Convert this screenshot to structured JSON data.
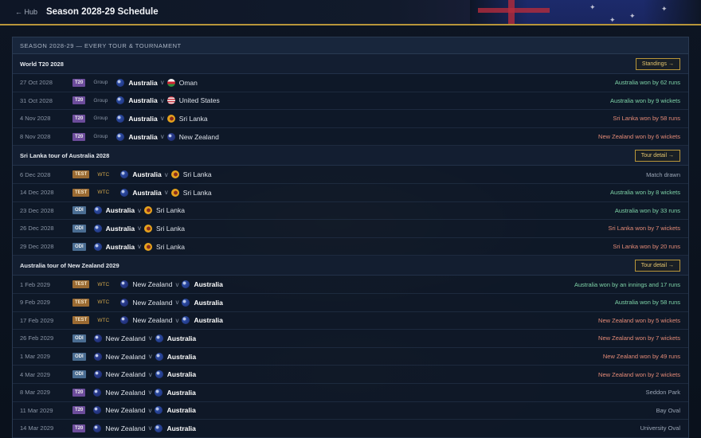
{
  "topbar": {
    "back_label": "← Hub",
    "title": "Season 2028-29 Schedule"
  },
  "panel": {
    "header": "SEASON 2028-29 — EVERY TOUR & TOURNAMENT"
  },
  "sections": [
    {
      "title": "World T20 2028",
      "button": "Standings →",
      "matches": [
        {
          "date": "27 Oct 2028",
          "format": "T20",
          "comp": "Group",
          "home": "Australia",
          "home_flag": "aus",
          "away": "Oman",
          "away_flag": "oman",
          "bold": "home",
          "result": "Australia won by 62 runs",
          "result_type": "win"
        },
        {
          "date": "31 Oct 2028",
          "format": "T20",
          "comp": "Group",
          "home": "Australia",
          "home_flag": "aus",
          "away": "United States",
          "away_flag": "usa",
          "bold": "home",
          "result": "Australia won by 9 wickets",
          "result_type": "win"
        },
        {
          "date": "4 Nov 2028",
          "format": "T20",
          "comp": "Group",
          "home": "Australia",
          "home_flag": "aus",
          "away": "Sri Lanka",
          "away_flag": "sl",
          "bold": "home",
          "result": "Sri Lanka won by 58 runs",
          "result_type": "loss"
        },
        {
          "date": "8 Nov 2028",
          "format": "T20",
          "comp": "Group",
          "home": "Australia",
          "home_flag": "aus",
          "away": "New Zealand",
          "away_flag": "nz",
          "bold": "home",
          "result": "New Zealand won by 6 wickets",
          "result_type": "loss"
        }
      ]
    },
    {
      "title": "Sri Lanka tour of Australia 2028",
      "button": "Tour detail →",
      "matches": [
        {
          "date": "6 Dec 2028",
          "format": "TEST",
          "comp": "WTC",
          "home": "Australia",
          "home_flag": "aus",
          "away": "Sri Lanka",
          "away_flag": "sl",
          "bold": "home",
          "result": "Match drawn",
          "result_type": "neutral"
        },
        {
          "date": "14 Dec 2028",
          "format": "TEST",
          "comp": "WTC",
          "home": "Australia",
          "home_flag": "aus",
          "away": "Sri Lanka",
          "away_flag": "sl",
          "bold": "home",
          "result": "Australia won by 8 wickets",
          "result_type": "win"
        },
        {
          "date": "23 Dec 2028",
          "format": "ODI",
          "comp": "",
          "home": "Australia",
          "home_flag": "aus",
          "away": "Sri Lanka",
          "away_flag": "sl",
          "bold": "home",
          "result": "Australia won by 33 runs",
          "result_type": "win"
        },
        {
          "date": "26 Dec 2028",
          "format": "ODI",
          "comp": "",
          "home": "Australia",
          "home_flag": "aus",
          "away": "Sri Lanka",
          "away_flag": "sl",
          "bold": "home",
          "result": "Sri Lanka won by 7 wickets",
          "result_type": "loss"
        },
        {
          "date": "29 Dec 2028",
          "format": "ODI",
          "comp": "",
          "home": "Australia",
          "home_flag": "aus",
          "away": "Sri Lanka",
          "away_flag": "sl",
          "bold": "home",
          "result": "Sri Lanka won by 20 runs",
          "result_type": "loss"
        }
      ]
    },
    {
      "title": "Australia tour of New Zealand 2029",
      "button": "Tour detail →",
      "matches": [
        {
          "date": "1 Feb 2029",
          "format": "TEST",
          "comp": "WTC",
          "home": "New Zealand",
          "home_flag": "nz",
          "away": "Australia",
          "away_flag": "aus",
          "bold": "away",
          "result": "Australia won by an innings and 17 runs",
          "result_type": "win"
        },
        {
          "date": "9 Feb 2029",
          "format": "TEST",
          "comp": "WTC",
          "home": "New Zealand",
          "home_flag": "nz",
          "away": "Australia",
          "away_flag": "aus",
          "bold": "away",
          "result": "Australia won by 58 runs",
          "result_type": "win"
        },
        {
          "date": "17 Feb 2029",
          "format": "TEST",
          "comp": "WTC",
          "home": "New Zealand",
          "home_flag": "nz",
          "away": "Australia",
          "away_flag": "aus",
          "bold": "away",
          "result": "New Zealand won by 5 wickets",
          "result_type": "loss"
        },
        {
          "date": "26 Feb 2029",
          "format": "ODI",
          "comp": "",
          "home": "New Zealand",
          "home_flag": "nz",
          "away": "Australia",
          "away_flag": "aus",
          "bold": "away",
          "result": "New Zealand won by 7 wickets",
          "result_type": "loss"
        },
        {
          "date": "1 Mar 2029",
          "format": "ODI",
          "comp": "",
          "home": "New Zealand",
          "home_flag": "nz",
          "away": "Australia",
          "away_flag": "aus",
          "bold": "away",
          "result": "New Zealand won by 49 runs",
          "result_type": "loss"
        },
        {
          "date": "4 Mar 2029",
          "format": "ODI",
          "comp": "",
          "home": "New Zealand",
          "home_flag": "nz",
          "away": "Australia",
          "away_flag": "aus",
          "bold": "away",
          "result": "New Zealand won by 2 wickets",
          "result_type": "loss"
        },
        {
          "date": "8 Mar 2029",
          "format": "T20",
          "comp": "",
          "home": "New Zealand",
          "home_flag": "nz",
          "away": "Australia",
          "away_flag": "aus",
          "bold": "away",
          "result": "Seddon Park",
          "result_type": "neutral"
        },
        {
          "date": "11 Mar 2029",
          "format": "T20",
          "comp": "",
          "home": "New Zealand",
          "home_flag": "nz",
          "away": "Australia",
          "away_flag": "aus",
          "bold": "away",
          "result": "Bay Oval",
          "result_type": "neutral"
        },
        {
          "date": "14 Mar 2029",
          "format": "T20",
          "comp": "",
          "home": "New Zealand",
          "home_flag": "nz",
          "away": "Australia",
          "away_flag": "aus",
          "bold": "away",
          "result": "University Oval",
          "result_type": "neutral"
        }
      ]
    }
  ],
  "colors": {
    "accent": "#b8963a",
    "win": "#7ed3a7",
    "loss": "#e58b77",
    "t20": "#6c4c9b",
    "test": "#9a6a32",
    "odi": "#4a6d92"
  }
}
